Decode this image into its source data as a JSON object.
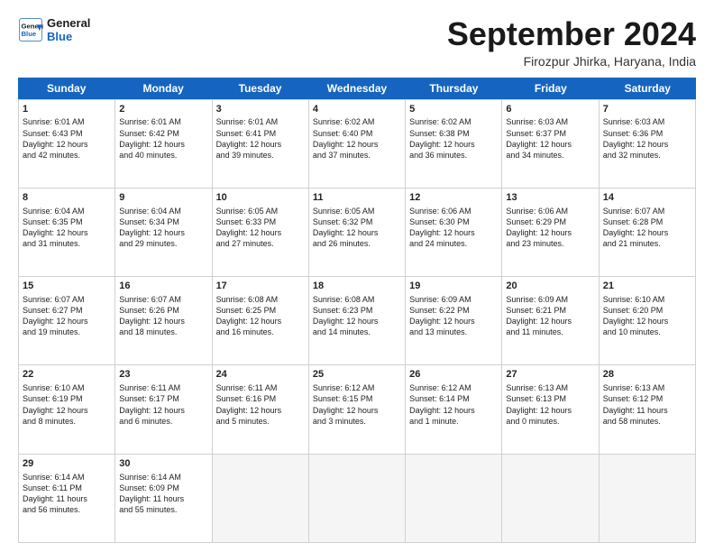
{
  "header": {
    "logo_line1": "General",
    "logo_line2": "Blue",
    "month": "September 2024",
    "location": "Firozpur Jhirka, Haryana, India"
  },
  "weekdays": [
    "Sunday",
    "Monday",
    "Tuesday",
    "Wednesday",
    "Thursday",
    "Friday",
    "Saturday"
  ],
  "rows": [
    [
      {
        "day": "",
        "empty": true
      },
      {
        "day": "",
        "empty": true
      },
      {
        "day": "",
        "empty": true
      },
      {
        "day": "",
        "empty": true
      },
      {
        "day": "",
        "empty": true
      },
      {
        "day": "",
        "empty": true
      },
      {
        "day": "",
        "empty": true
      }
    ],
    [
      {
        "day": "1",
        "lines": [
          "Sunrise: 6:01 AM",
          "Sunset: 6:43 PM",
          "Daylight: 12 hours",
          "and 42 minutes."
        ]
      },
      {
        "day": "2",
        "lines": [
          "Sunrise: 6:01 AM",
          "Sunset: 6:42 PM",
          "Daylight: 12 hours",
          "and 40 minutes."
        ]
      },
      {
        "day": "3",
        "lines": [
          "Sunrise: 6:01 AM",
          "Sunset: 6:41 PM",
          "Daylight: 12 hours",
          "and 39 minutes."
        ]
      },
      {
        "day": "4",
        "lines": [
          "Sunrise: 6:02 AM",
          "Sunset: 6:40 PM",
          "Daylight: 12 hours",
          "and 37 minutes."
        ]
      },
      {
        "day": "5",
        "lines": [
          "Sunrise: 6:02 AM",
          "Sunset: 6:38 PM",
          "Daylight: 12 hours",
          "and 36 minutes."
        ]
      },
      {
        "day": "6",
        "lines": [
          "Sunrise: 6:03 AM",
          "Sunset: 6:37 PM",
          "Daylight: 12 hours",
          "and 34 minutes."
        ]
      },
      {
        "day": "7",
        "lines": [
          "Sunrise: 6:03 AM",
          "Sunset: 6:36 PM",
          "Daylight: 12 hours",
          "and 32 minutes."
        ]
      }
    ],
    [
      {
        "day": "8",
        "lines": [
          "Sunrise: 6:04 AM",
          "Sunset: 6:35 PM",
          "Daylight: 12 hours",
          "and 31 minutes."
        ]
      },
      {
        "day": "9",
        "lines": [
          "Sunrise: 6:04 AM",
          "Sunset: 6:34 PM",
          "Daylight: 12 hours",
          "and 29 minutes."
        ]
      },
      {
        "day": "10",
        "lines": [
          "Sunrise: 6:05 AM",
          "Sunset: 6:33 PM",
          "Daylight: 12 hours",
          "and 27 minutes."
        ]
      },
      {
        "day": "11",
        "lines": [
          "Sunrise: 6:05 AM",
          "Sunset: 6:32 PM",
          "Daylight: 12 hours",
          "and 26 minutes."
        ]
      },
      {
        "day": "12",
        "lines": [
          "Sunrise: 6:06 AM",
          "Sunset: 6:30 PM",
          "Daylight: 12 hours",
          "and 24 minutes."
        ]
      },
      {
        "day": "13",
        "lines": [
          "Sunrise: 6:06 AM",
          "Sunset: 6:29 PM",
          "Daylight: 12 hours",
          "and 23 minutes."
        ]
      },
      {
        "day": "14",
        "lines": [
          "Sunrise: 6:07 AM",
          "Sunset: 6:28 PM",
          "Daylight: 12 hours",
          "and 21 minutes."
        ]
      }
    ],
    [
      {
        "day": "15",
        "lines": [
          "Sunrise: 6:07 AM",
          "Sunset: 6:27 PM",
          "Daylight: 12 hours",
          "and 19 minutes."
        ]
      },
      {
        "day": "16",
        "lines": [
          "Sunrise: 6:07 AM",
          "Sunset: 6:26 PM",
          "Daylight: 12 hours",
          "and 18 minutes."
        ]
      },
      {
        "day": "17",
        "lines": [
          "Sunrise: 6:08 AM",
          "Sunset: 6:25 PM",
          "Daylight: 12 hours",
          "and 16 minutes."
        ]
      },
      {
        "day": "18",
        "lines": [
          "Sunrise: 6:08 AM",
          "Sunset: 6:23 PM",
          "Daylight: 12 hours",
          "and 14 minutes."
        ]
      },
      {
        "day": "19",
        "lines": [
          "Sunrise: 6:09 AM",
          "Sunset: 6:22 PM",
          "Daylight: 12 hours",
          "and 13 minutes."
        ]
      },
      {
        "day": "20",
        "lines": [
          "Sunrise: 6:09 AM",
          "Sunset: 6:21 PM",
          "Daylight: 12 hours",
          "and 11 minutes."
        ]
      },
      {
        "day": "21",
        "lines": [
          "Sunrise: 6:10 AM",
          "Sunset: 6:20 PM",
          "Daylight: 12 hours",
          "and 10 minutes."
        ]
      }
    ],
    [
      {
        "day": "22",
        "lines": [
          "Sunrise: 6:10 AM",
          "Sunset: 6:19 PM",
          "Daylight: 12 hours",
          "and 8 minutes."
        ]
      },
      {
        "day": "23",
        "lines": [
          "Sunrise: 6:11 AM",
          "Sunset: 6:17 PM",
          "Daylight: 12 hours",
          "and 6 minutes."
        ]
      },
      {
        "day": "24",
        "lines": [
          "Sunrise: 6:11 AM",
          "Sunset: 6:16 PM",
          "Daylight: 12 hours",
          "and 5 minutes."
        ]
      },
      {
        "day": "25",
        "lines": [
          "Sunrise: 6:12 AM",
          "Sunset: 6:15 PM",
          "Daylight: 12 hours",
          "and 3 minutes."
        ]
      },
      {
        "day": "26",
        "lines": [
          "Sunrise: 6:12 AM",
          "Sunset: 6:14 PM",
          "Daylight: 12 hours",
          "and 1 minute."
        ]
      },
      {
        "day": "27",
        "lines": [
          "Sunrise: 6:13 AM",
          "Sunset: 6:13 PM",
          "Daylight: 12 hours",
          "and 0 minutes."
        ]
      },
      {
        "day": "28",
        "lines": [
          "Sunrise: 6:13 AM",
          "Sunset: 6:12 PM",
          "Daylight: 11 hours",
          "and 58 minutes."
        ]
      }
    ],
    [
      {
        "day": "29",
        "lines": [
          "Sunrise: 6:14 AM",
          "Sunset: 6:11 PM",
          "Daylight: 11 hours",
          "and 56 minutes."
        ]
      },
      {
        "day": "30",
        "lines": [
          "Sunrise: 6:14 AM",
          "Sunset: 6:09 PM",
          "Daylight: 11 hours",
          "and 55 minutes."
        ]
      },
      {
        "day": "",
        "empty": true
      },
      {
        "day": "",
        "empty": true
      },
      {
        "day": "",
        "empty": true
      },
      {
        "day": "",
        "empty": true
      },
      {
        "day": "",
        "empty": true
      }
    ]
  ]
}
